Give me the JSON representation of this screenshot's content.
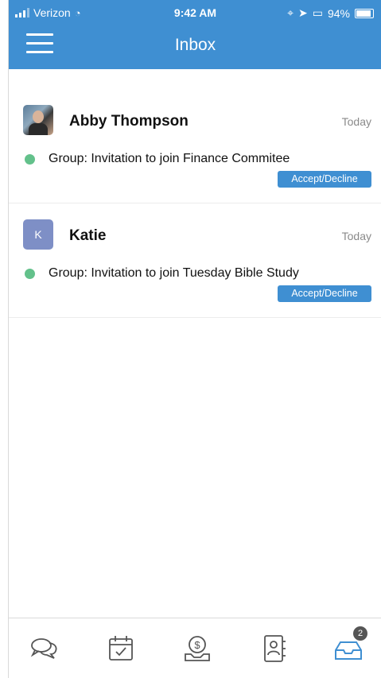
{
  "status_bar": {
    "carrier": "Verizon",
    "time": "9:42 AM",
    "battery": "94%"
  },
  "header": {
    "title": "Inbox"
  },
  "messages": [
    {
      "sender": "Abby Thompson",
      "date": "Today",
      "subject": "Group: Invitation to join Finance Commitee",
      "action": "Accept/Decline",
      "avatar_letter": ""
    },
    {
      "sender": "Katie",
      "date": "Today",
      "subject": "Group: Invitation to join Tuesday Bible Study",
      "action": "Accept/Decline",
      "avatar_letter": "K"
    }
  ],
  "tabbar": {
    "items": [
      "chat-icon",
      "calendar-check-icon",
      "giving-icon",
      "directory-icon",
      "inbox-icon"
    ],
    "inbox_badge": "2"
  },
  "colors": {
    "accent": "#3f8fd2",
    "status_dot": "#63c18b",
    "avatar_letter_bg": "#7e8fc6"
  }
}
